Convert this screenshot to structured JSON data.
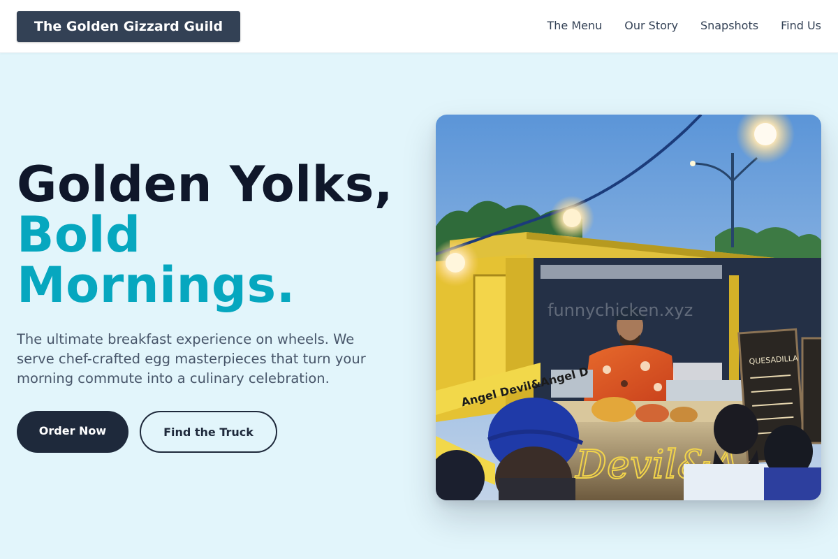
{
  "header": {
    "brand": "The Golden Gizzard Guild",
    "nav": [
      "The Menu",
      "Our Story",
      "Snapshots",
      "Find Us"
    ]
  },
  "hero": {
    "title_line1": "Golden Yolks,",
    "title_line2": "Bold",
    "title_line3": "Mornings.",
    "description": "The ultimate breakfast experience on wheels. We serve chef-crafted egg masterpieces that turn your morning commute into a culinary celebration.",
    "primary_button": "Order Now",
    "secondary_button": "Find the Truck"
  },
  "photo": {
    "watermark": "funnychicken.xyz",
    "sign_text": "Devil&A",
    "banner_text": "Angel Devil&Angel D",
    "menu_board_title": "QUESADILLA"
  },
  "colors": {
    "accent": "#06a7bf",
    "dark": "#1e293b",
    "background": "#e2f5fb",
    "brand_bg": "#334155"
  }
}
